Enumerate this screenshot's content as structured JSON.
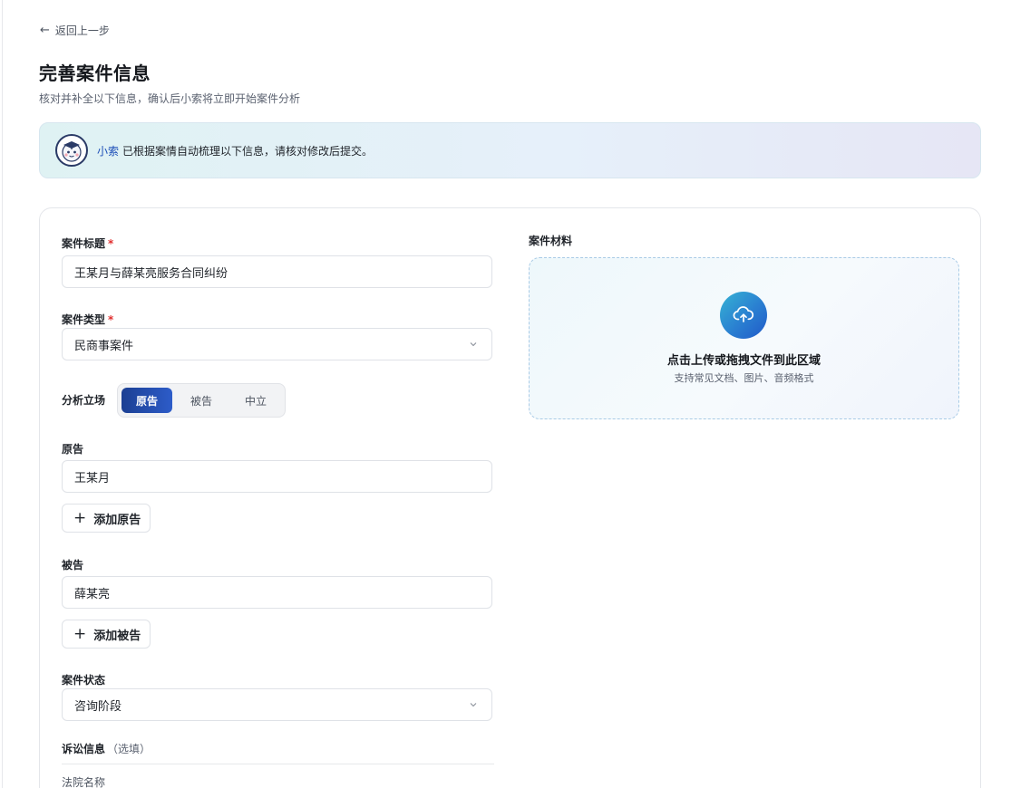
{
  "nav": {
    "back_label": "返回上一步"
  },
  "header": {
    "title": "完善案件信息",
    "subtitle": "核对并补全以下信息，确认后小索将立即开始案件分析"
  },
  "banner": {
    "assistant_name": "小索",
    "message": "已根据案情自动梳理以下信息，请核对修改后提交。"
  },
  "form": {
    "case_title": {
      "label": "案件标题",
      "required_mark": "*",
      "value": "王某月与薛某亮服务合同纠纷"
    },
    "case_type": {
      "label": "案件类型",
      "required_mark": "*",
      "value": "民商事案件"
    },
    "stance": {
      "label": "分析立场",
      "options": [
        "原告",
        "被告",
        "中立"
      ],
      "selected": "原告"
    },
    "plaintiff": {
      "label": "原告",
      "value": "王某月",
      "add_label": "添加原告"
    },
    "defendant": {
      "label": "被告",
      "value": "薛某亮",
      "add_label": "添加被告"
    },
    "case_status": {
      "label": "案件状态",
      "value": "咨询阶段"
    },
    "litigation": {
      "label": "诉讼信息",
      "optional_note": "（选填）",
      "court_label": "法院名称"
    }
  },
  "materials": {
    "label": "案件材料",
    "upload_title": "点击上传或拖拽文件到此区域",
    "upload_hint": "支持常见文档、图片、音频格式"
  },
  "colors": {
    "accent": "#1b3f93",
    "accent_light": "#2d5cc9",
    "required": "#e02e2e",
    "assistant_name": "#1d4fb8"
  }
}
